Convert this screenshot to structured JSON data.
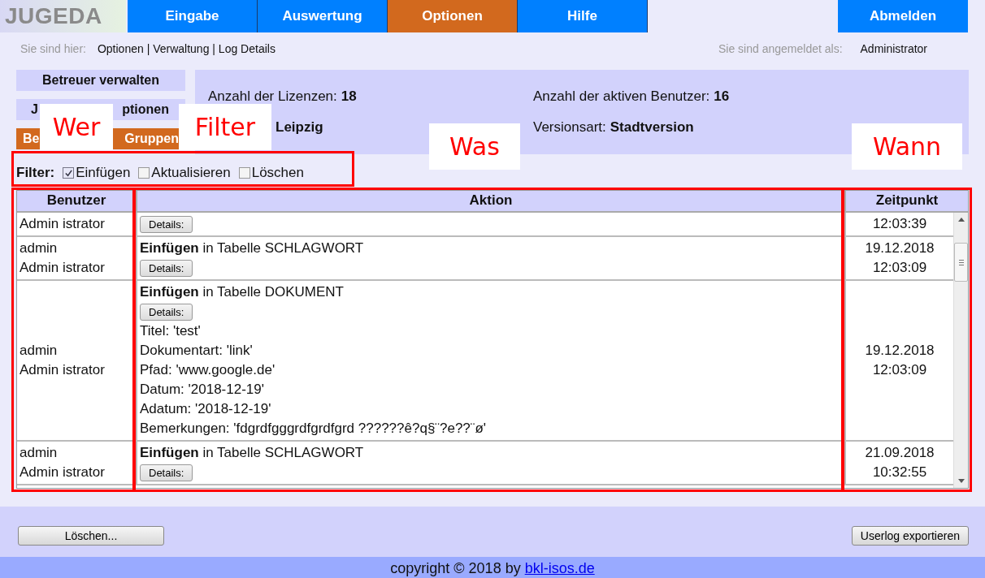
{
  "logo": {
    "text": "JUGEDA"
  },
  "nav": [
    {
      "label": "Eingabe",
      "selected": false
    },
    {
      "label": "Auswertung",
      "selected": false
    },
    {
      "label": "Optionen",
      "selected": true
    },
    {
      "label": "Hilfe",
      "selected": false
    }
  ],
  "logout": {
    "label": "Abmelden"
  },
  "breadcrumb": {
    "label": "Sie sind hier:",
    "path": "Optionen | Verwaltung | Log Details"
  },
  "login": {
    "label": "Sie sind angemeldet als:",
    "user": "Administrator"
  },
  "sidebar": {
    "items": [
      {
        "parts": [
          "Betreuer verwalten"
        ],
        "selected": false
      },
      {
        "parts": [
          "J",
          "ptionen"
        ],
        "selected": false
      },
      {
        "parts": [
          "Be",
          "Gruppen"
        ],
        "selected": true
      }
    ]
  },
  "info": [
    {
      "label": "Anzahl der Lizenzen:",
      "value": "18"
    },
    {
      "label": "Anzahl der aktiven Benutzer:",
      "value": "16"
    },
    {
      "value": "Leipzig"
    },
    {
      "label": "Versionsart:",
      "value": "Stadtversion"
    }
  ],
  "filter": {
    "label": "Filter:",
    "options": [
      {
        "label": "Einfügen",
        "checked": true
      },
      {
        "label": "Aktualisieren",
        "checked": false
      },
      {
        "label": "Löschen",
        "checked": false
      }
    ]
  },
  "table": {
    "columns": [
      "Benutzer",
      "Aktion",
      "Zeitpunkt"
    ],
    "rows": [
      {
        "user": [
          "Admin istrator"
        ],
        "button": "Details:",
        "time": [
          "12:03:39"
        ]
      },
      {
        "user": [
          "admin",
          "Admin istrator"
        ],
        "action": "**Einfügen** in Tabelle SCHLAGWORT",
        "button": "Details:",
        "time": [
          "19.12.2018",
          "12:03:09"
        ]
      },
      {
        "user": [
          "admin",
          "Admin istrator"
        ],
        "action": "**Einfügen** in Tabelle DOKUMENT",
        "button": "Details:",
        "details": [
          "Titel: 'test'",
          "Dokumentart: 'link'",
          "Pfad: 'www.google.de'",
          "Datum: '2018-12-19'",
          "Adatum: '2018-12-19'",
          "Bemerkungen: 'fdgrdfgggrdfgrdfgrd ??????ê?q§¨?e??¨ø'"
        ],
        "time": [
          "19.12.2018",
          "12:03:09"
        ]
      },
      {
        "user": [
          "admin",
          "Admin istrator"
        ],
        "action": "**Einfügen** in Tabelle SCHLAGWORT",
        "button": "Details:",
        "time": [
          "21.09.2018",
          "10:32:55"
        ]
      }
    ]
  },
  "buttons": [
    {
      "label": "Löschen..."
    },
    {
      "label": "Userlog exportieren"
    }
  ],
  "footer": {
    "text": "copyright © 2018 by",
    "link": "bkl-isos.de"
  },
  "annotations": [
    {
      "kind": "frame"
    },
    {
      "kind": "frame"
    },
    {
      "kind": "frame"
    },
    {
      "kind": "frame"
    },
    {
      "kind": "label",
      "text": "Wer"
    },
    {
      "kind": "label",
      "text": "Filter"
    },
    {
      "kind": "label",
      "text": "Was"
    },
    {
      "kind": "label",
      "text": "Wann"
    }
  ]
}
